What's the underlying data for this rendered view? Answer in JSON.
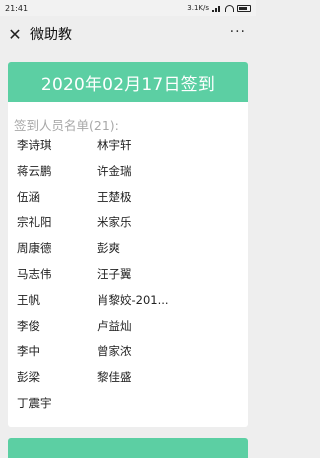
{
  "status_bar": {
    "time": "21:41",
    "network_speed": "3.1K/s"
  },
  "nav": {
    "title": "微助教"
  },
  "card": {
    "header_title": "2020年02月17日签到",
    "list_label": "签到人员名单(21):",
    "names": [
      "李诗琪",
      "林宇轩",
      "蒋云鹏",
      "许金瑞",
      "伍涵",
      "王楚极",
      "宗礼阳",
      "米家乐",
      "周康德",
      "彭爽",
      "马志伟",
      "汪子翼",
      "王帆",
      "肖黎姣-201...",
      "李俊",
      "卢益灿",
      "李中",
      "曾家浓",
      "彭梁",
      "黎佳盛",
      "丁震宇"
    ]
  },
  "colors": {
    "accent": "#5ccfa3",
    "background": "#eeeeee",
    "label_gray": "#a8a8a8"
  },
  "icons": [
    "close-icon",
    "more-icon",
    "signal-icon",
    "wifi-icon",
    "battery-icon"
  ]
}
